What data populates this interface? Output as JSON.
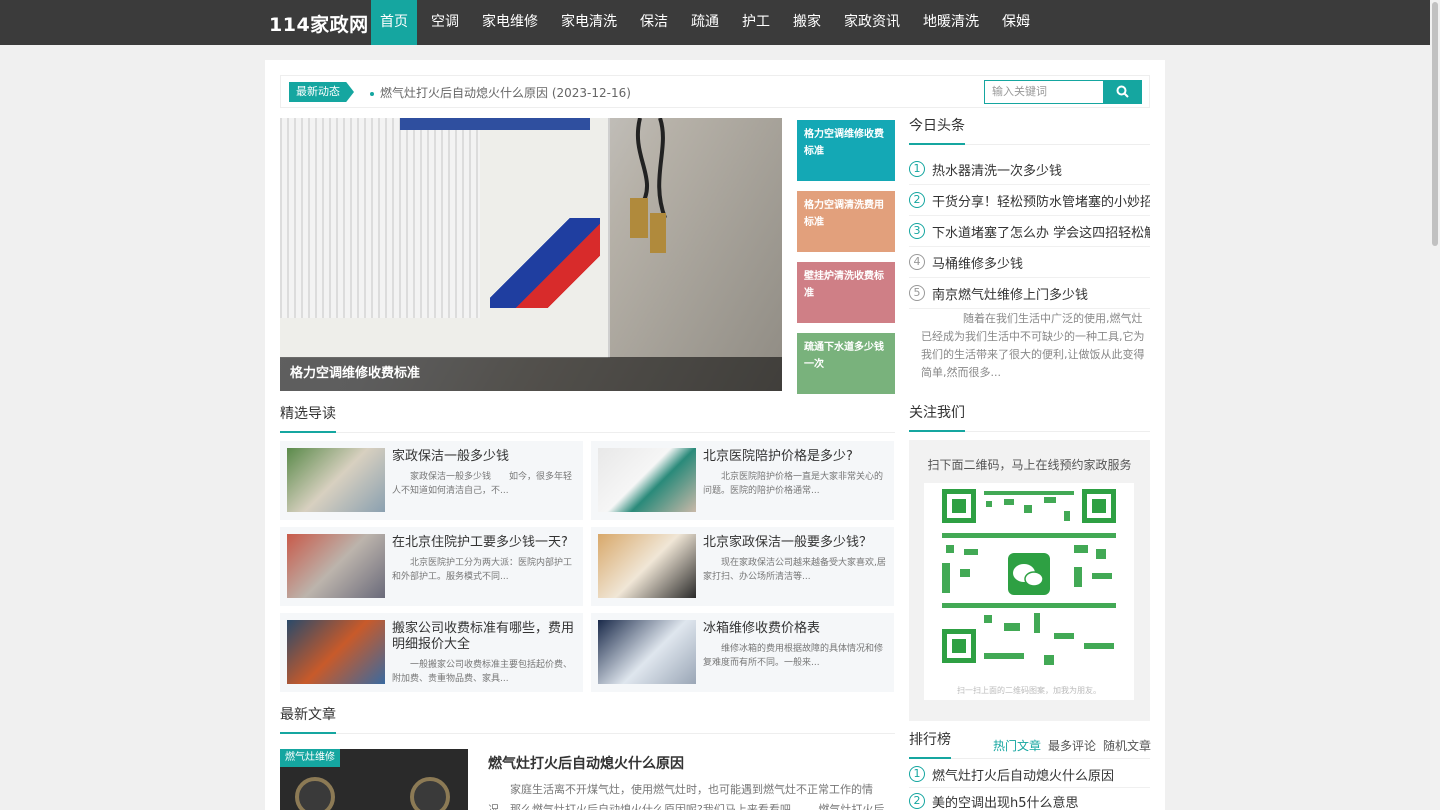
{
  "site": {
    "logo": "114家政网"
  },
  "nav": [
    "首页",
    "空调",
    "家电维修",
    "家电清洗",
    "保洁",
    "疏通",
    "护工",
    "搬家",
    "家政资讯",
    "地暖清洗",
    "保姆"
  ],
  "newsbar": {
    "tag": "最新动态",
    "item": "燃气灶打火后自动熄火什么原因 (2023-12-16)",
    "search_placeholder": "输入关键词"
  },
  "slider": {
    "caption": "格力空调维修收费标准"
  },
  "tiles": [
    {
      "label": "格力空调维修收费标准",
      "color": "#14a8b5"
    },
    {
      "label": "格力空调清洗费用标准",
      "color": "#e2a07c"
    },
    {
      "label": "壁挂炉清洗收费标准",
      "color": "#cf7f86"
    },
    {
      "label": "疏通下水道多少钱一次",
      "color": "#79b27c"
    }
  ],
  "headlines": {
    "title": "今日头条",
    "items": [
      {
        "n": "1",
        "text": "热水器清洗一次多少钱"
      },
      {
        "n": "2",
        "text": "干货分享！轻松预防水管堵塞的小妙招"
      },
      {
        "n": "3",
        "text": "下水道堵塞了怎么办 学会这四招轻松解"
      },
      {
        "n": "4",
        "text": "马桶维修多少钱"
      },
      {
        "n": "5",
        "text": "南京燃气灶维修上门多少钱"
      }
    ],
    "intro": "随着在我们生活中广泛的使用,燃气灶已经成为我们生活中不可缺少的一种工具,它为我们的生活带来了很大的便利,让做饭从此变得简单,然而很多..."
  },
  "featured": {
    "title": "精选导读",
    "cards": [
      {
        "title": "家政保洁一般多少钱",
        "desc": "家政保洁一般多少钱　　如今，很多年轻人不知道如何清洁自己，不..."
      },
      {
        "title": "北京医院陪护价格是多少?",
        "desc": "北京医院陪护价格一直是大家非常关心的问题。医院的陪护价格通常..."
      },
      {
        "title": "在北京住院护工要多少钱一天?",
        "desc": "北京医院护工分为两大派：医院内部护工和外部护工。服务模式不同..."
      },
      {
        "title": "北京家政保洁一般要多少钱？",
        "desc": "现在家政保洁公司越来越备受大家喜欢,居家打扫、办公场所清洁等..."
      },
      {
        "title": "搬家公司收费标准有哪些，费用明细报价大全",
        "desc": "一般搬家公司收费标准主要包括起价费、附加费、贵重物品费、家具..."
      },
      {
        "title": "冰箱维修收费价格表",
        "desc": "维修冰箱的费用根据故障的具体情况和修复难度而有所不同。一般来..."
      }
    ]
  },
  "follow": {
    "title": "关注我们",
    "text": "扫下面二维码，马上在线预约家政服务",
    "qr_caption": "扫一扫上面的二维码图案，加我为朋友。"
  },
  "latest": {
    "title": "最新文章",
    "tag": "燃气灶维修",
    "article_title": "燃气灶打火后自动熄火什么原因",
    "desc": "家庭生活离不开煤气灶，使用燃气灶时，也可能遇到燃气灶不正常工作的情况。那么燃气灶打火后自动熄火什么原因呢?我们马上来看看吧。　　燃气灶打火后自动熄火什"
  },
  "rank": {
    "title": "排行榜",
    "tabs": [
      "热门文章",
      "最多评论",
      "随机文章"
    ],
    "items": [
      {
        "n": "1",
        "text": "燃气灶打火后自动熄火什么原因"
      },
      {
        "n": "2",
        "text": "美的空调出现h5什么意思"
      }
    ]
  },
  "colors": {
    "accent": "#15a6a0",
    "nav_bg": "#3b3b3b"
  }
}
